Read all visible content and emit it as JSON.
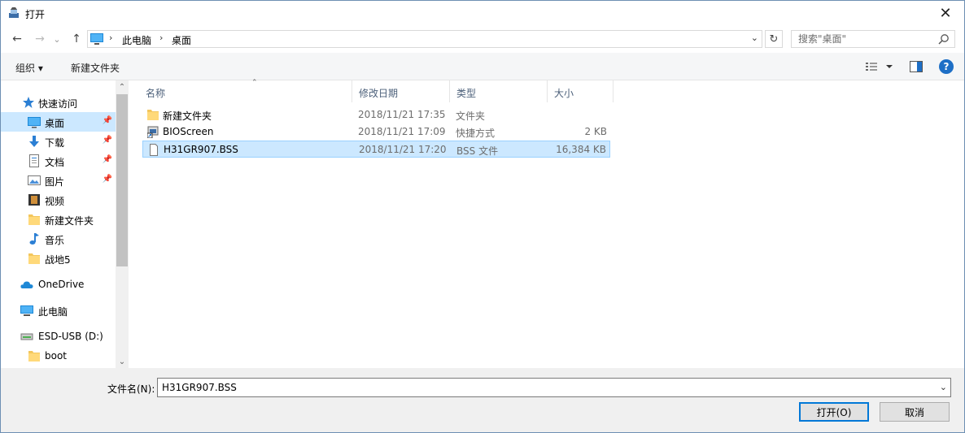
{
  "window": {
    "title": "打开",
    "close_glyph": "✕"
  },
  "address": {
    "back": "←",
    "forward": "→",
    "recent": "⌄",
    "up": "↑",
    "crumbs": [
      "此电脑",
      "桌面"
    ],
    "crumb_sep": "›",
    "dropdown": "⌄",
    "refresh": "↻"
  },
  "search": {
    "placeholder": "搜索\"桌面\""
  },
  "toolbar": {
    "organize": "组织 ▾",
    "new_folder": "新建文件夹",
    "help": "?"
  },
  "nav": {
    "items": [
      {
        "label": "快速访问",
        "icon": "star-icon"
      },
      {
        "label": "桌面",
        "icon": "desktop-icon",
        "pinned": true,
        "selected": true
      },
      {
        "label": "下载",
        "icon": "download-icon",
        "pinned": true
      },
      {
        "label": "文档",
        "icon": "document-icon",
        "pinned": true
      },
      {
        "label": "图片",
        "icon": "picture-icon",
        "pinned": true
      },
      {
        "label": "视频",
        "icon": "video-icon"
      },
      {
        "label": "新建文件夹",
        "icon": "folder-icon"
      },
      {
        "label": "音乐",
        "icon": "music-icon"
      },
      {
        "label": "战地5",
        "icon": "folder-icon"
      },
      {
        "label": "OneDrive",
        "icon": "cloud-icon"
      },
      {
        "label": "此电脑",
        "icon": "computer-icon"
      },
      {
        "label": "ESD-USB (D:)",
        "icon": "drive-icon"
      },
      {
        "label": "boot",
        "icon": "folder-icon"
      }
    ],
    "pin_glyph": "📌",
    "scroll_up": "⌃",
    "scroll_down": "⌄"
  },
  "columns": {
    "name": "名称",
    "date": "修改日期",
    "type": "类型",
    "size": "大小",
    "sort_glyph": "⌃"
  },
  "files": [
    {
      "name": "新建文件夹",
      "date": "2018/11/21 17:35",
      "type": "文件夹",
      "size": "",
      "icon": "folder-icon"
    },
    {
      "name": "BIOScreen",
      "date": "2018/11/21 17:09",
      "type": "快捷方式",
      "size": "2 KB",
      "icon": "shortcut-icon"
    },
    {
      "name": "H31GR907.BSS",
      "date": "2018/11/21 17:20",
      "type": "BSS 文件",
      "size": "16,384 KB",
      "icon": "file-icon",
      "selected": true
    }
  ],
  "bottom": {
    "filename_label": "文件名(N):",
    "filename_value": "H31GR907.BSS",
    "open": "打开(O)",
    "cancel": "取消"
  }
}
